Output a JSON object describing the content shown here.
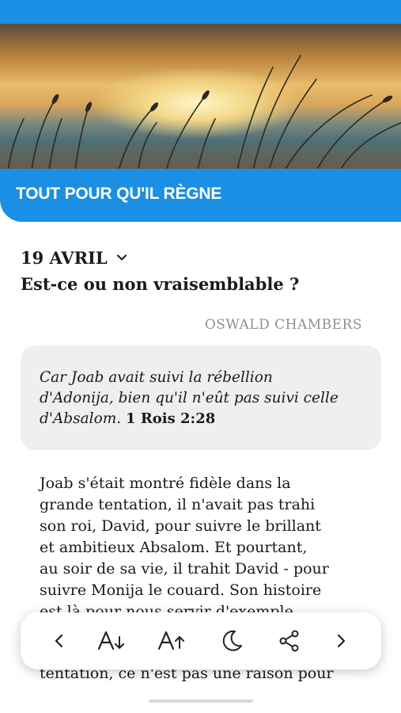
{
  "header": {
    "title": "TOUT POUR QU'IL RÈGNE"
  },
  "devotional": {
    "date": "19 AVRIL",
    "title": "Est-ce ou non vraisemblable ?",
    "author": "OSWALD CHAMBERS",
    "verse": {
      "lines": [
        "Car Joab avait suivi la rébellion",
        "d'Adonija, bien qu'il n'eût pas suivi celle",
        "d'Absalom."
      ],
      "reference": "1 Rois 2:28"
    },
    "body_lines": [
      "Joab s'était montré fidèle dans la",
      "grande tentation, il n'avait pas trahi",
      "son roi, David, pour suivre le brillant",
      "et ambitieux Absalom. Et pourtant,",
      "au soir de sa vie, il trahit David - pour",
      "suivre Monija le couard. Son histoire",
      "est là pour nous servir d'exemple"
    ],
    "body_line_after_toolbar": "tentation, ce n'est pas une raison pour"
  },
  "toolbar": {
    "buttons": [
      "previous",
      "decrease-font",
      "increase-font",
      "night-mode",
      "share",
      "next"
    ]
  },
  "colors": {
    "accent": "#1a8fe3",
    "verse_bg": "#efefef",
    "author_text": "#8f8f8f"
  }
}
